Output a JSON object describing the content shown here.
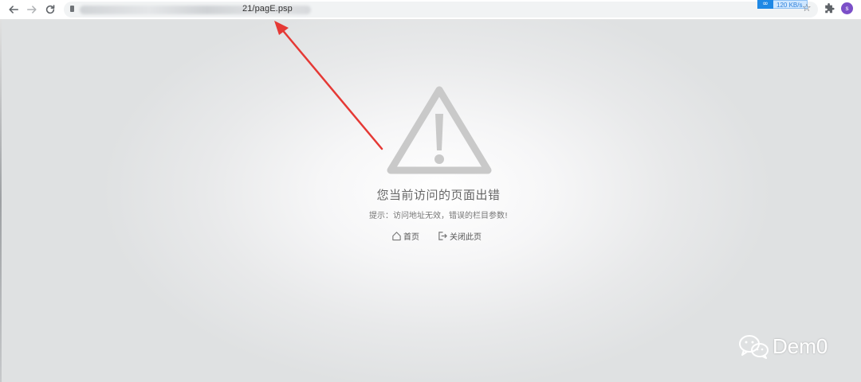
{
  "browser": {
    "url_visible_suffix": "21/pagE.psp",
    "speed_indicator": "120 KB/s",
    "avatar_initial": "s",
    "accent_color": "#7b4fc8"
  },
  "error_page": {
    "title": "您当前访问的页面出错",
    "hint": "提示：访问地址无效，错误的栏目参数!",
    "links": {
      "home": "首页",
      "close": "关闭此页"
    },
    "icon": "warning-triangle-icon"
  },
  "annotation": {
    "type": "arrow",
    "color": "#e53935",
    "points_to": "url-text"
  },
  "watermark": {
    "text": "Dem0",
    "icon": "wechat-icon"
  }
}
